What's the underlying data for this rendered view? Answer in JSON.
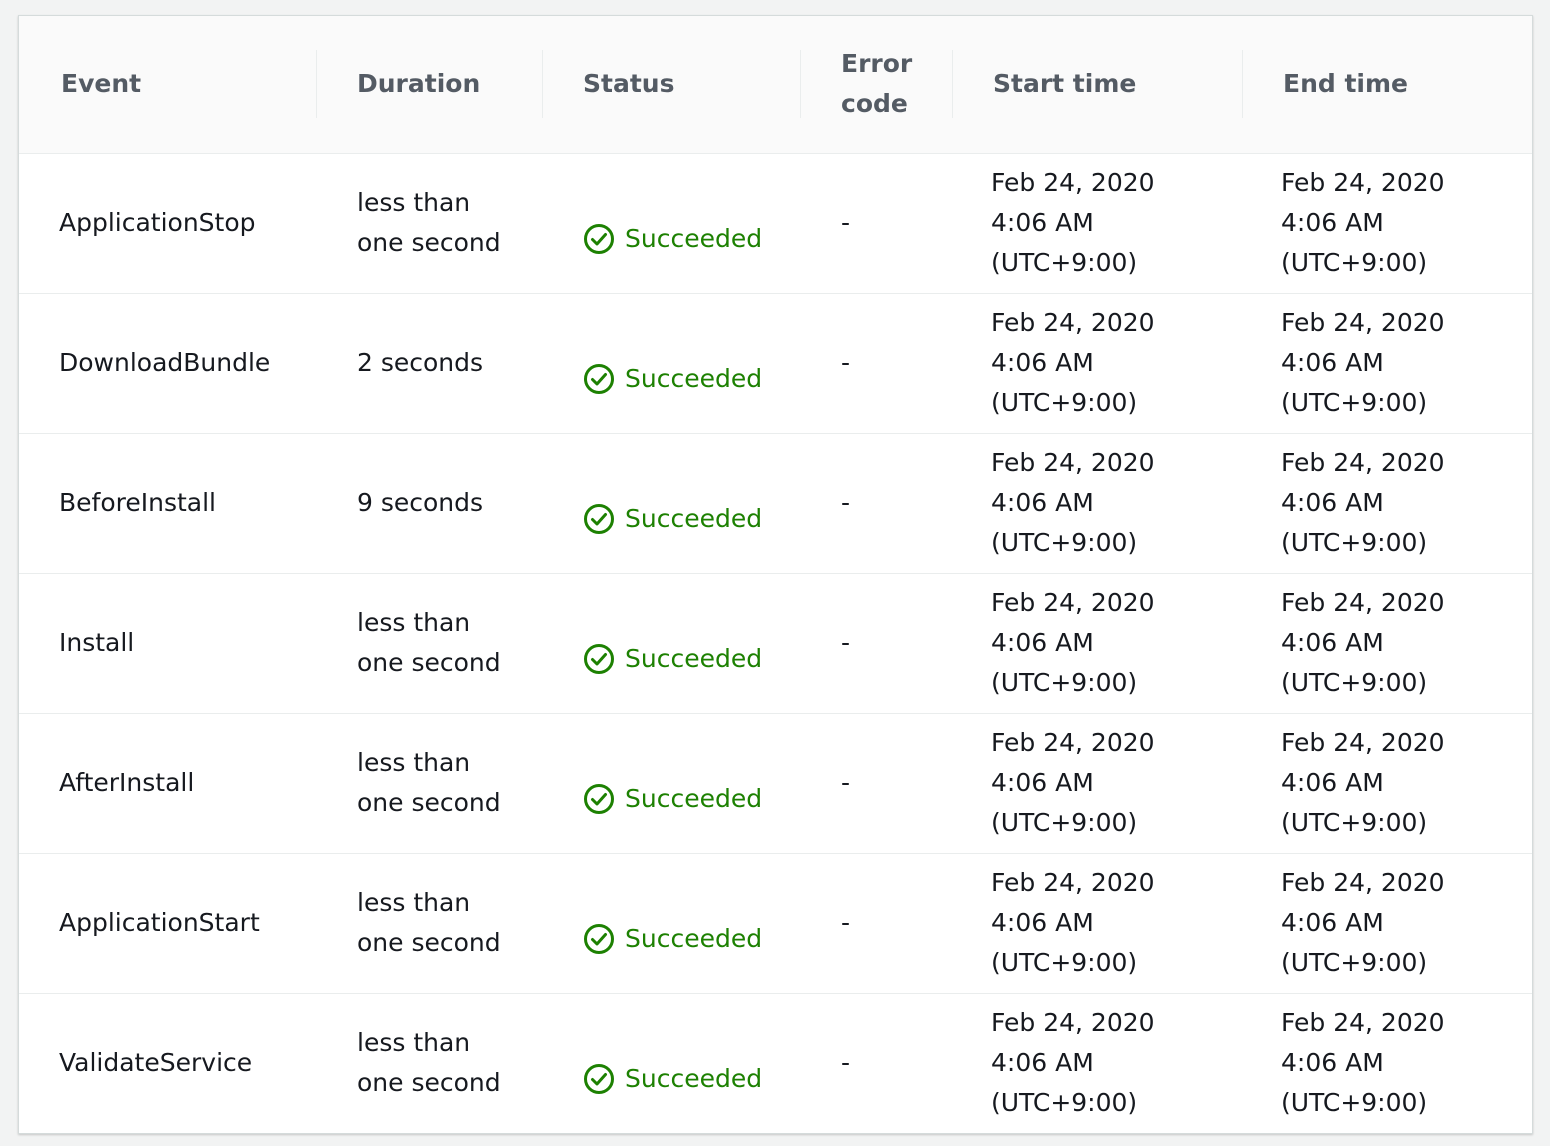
{
  "columns": [
    "Event",
    "Duration",
    "Status",
    "Error\ncode",
    "Start time",
    "End time"
  ],
  "status_color": "#1d8102",
  "status_icon": "check-circle-icon",
  "rows": [
    {
      "event": "ApplicationStop",
      "duration": "less than\none second",
      "status": "Succeeded",
      "error_code": "-",
      "start": "Feb 24, 2020\n4:06 AM\n(UTC+9:00)",
      "end": "Feb 24, 2020\n4:06 AM\n(UTC+9:00)"
    },
    {
      "event": "DownloadBundle",
      "duration": "2 seconds",
      "status": "Succeeded",
      "error_code": "-",
      "start": "Feb 24, 2020\n4:06 AM\n(UTC+9:00)",
      "end": "Feb 24, 2020\n4:06 AM\n(UTC+9:00)"
    },
    {
      "event": "BeforeInstall",
      "duration": "9 seconds",
      "status": "Succeeded",
      "error_code": "-",
      "start": "Feb 24, 2020\n4:06 AM\n(UTC+9:00)",
      "end": "Feb 24, 2020\n4:06 AM\n(UTC+9:00)"
    },
    {
      "event": "Install",
      "duration": "less than\none second",
      "status": "Succeeded",
      "error_code": "-",
      "start": "Feb 24, 2020\n4:06 AM\n(UTC+9:00)",
      "end": "Feb 24, 2020\n4:06 AM\n(UTC+9:00)"
    },
    {
      "event": "AfterInstall",
      "duration": "less than\none second",
      "status": "Succeeded",
      "error_code": "-",
      "start": "Feb 24, 2020\n4:06 AM\n(UTC+9:00)",
      "end": "Feb 24, 2020\n4:06 AM\n(UTC+9:00)"
    },
    {
      "event": "ApplicationStart",
      "duration": "less than\none second",
      "status": "Succeeded",
      "error_code": "-",
      "start": "Feb 24, 2020\n4:06 AM\n(UTC+9:00)",
      "end": "Feb 24, 2020\n4:06 AM\n(UTC+9:00)"
    },
    {
      "event": "ValidateService",
      "duration": "less than\none second",
      "status": "Succeeded",
      "error_code": "-",
      "start": "Feb 24, 2020\n4:06 AM\n(UTC+9:00)",
      "end": "Feb 24, 2020\n4:06 AM\n(UTC+9:00)"
    }
  ]
}
